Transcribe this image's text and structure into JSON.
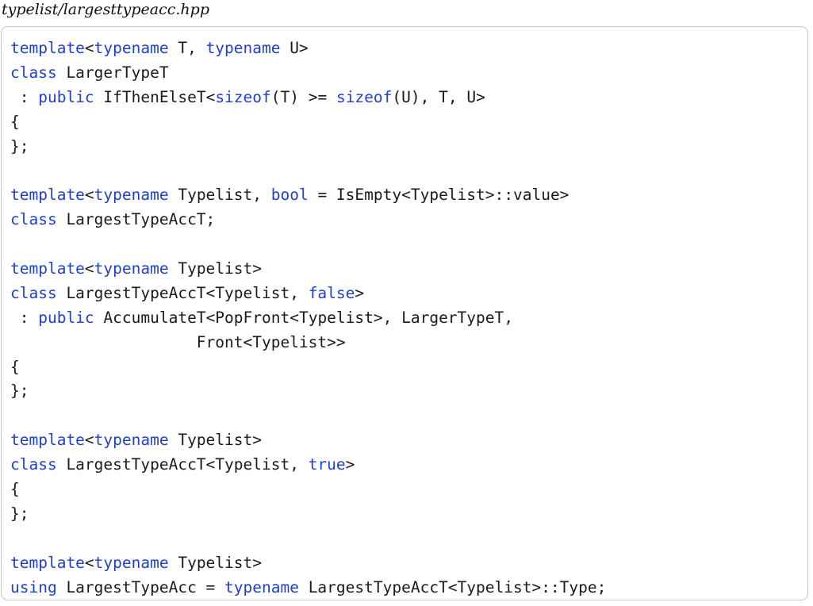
{
  "file": {
    "name": "typelist/largesttypeacc.hpp"
  },
  "colors": {
    "keyword": "#1f3fd1",
    "text": "#1a1a1a",
    "border": "#c8c8c8"
  },
  "code_lines": [
    [
      [
        "kw",
        "template"
      ],
      [
        "t",
        "<"
      ],
      [
        "kw",
        "typename"
      ],
      [
        "t",
        " T, "
      ],
      [
        "kw",
        "typename"
      ],
      [
        "t",
        " U>"
      ]
    ],
    [
      [
        "kw",
        "class"
      ],
      [
        "t",
        " LargerTypeT"
      ]
    ],
    [
      [
        "t",
        " : "
      ],
      [
        "kw",
        "public"
      ],
      [
        "t",
        " IfThenElseT<"
      ],
      [
        "kw",
        "sizeof"
      ],
      [
        "t",
        "(T) >= "
      ],
      [
        "kw",
        "sizeof"
      ],
      [
        "t",
        "(U), T, U>"
      ]
    ],
    [
      [
        "t",
        "{"
      ]
    ],
    [
      [
        "t",
        "};"
      ]
    ],
    [],
    [
      [
        "kw",
        "template"
      ],
      [
        "t",
        "<"
      ],
      [
        "kw",
        "typename"
      ],
      [
        "t",
        " Typelist, "
      ],
      [
        "kw",
        "bool"
      ],
      [
        "t",
        " = IsEmpty<Typelist>::value>"
      ]
    ],
    [
      [
        "kw",
        "class"
      ],
      [
        "t",
        " LargestTypeAccT;"
      ]
    ],
    [],
    [
      [
        "kw",
        "template"
      ],
      [
        "t",
        "<"
      ],
      [
        "kw",
        "typename"
      ],
      [
        "t",
        " Typelist>"
      ]
    ],
    [
      [
        "kw",
        "class"
      ],
      [
        "t",
        " LargestTypeAccT<Typelist, "
      ],
      [
        "kw",
        "false"
      ],
      [
        "t",
        ">"
      ]
    ],
    [
      [
        "t",
        " : "
      ],
      [
        "kw",
        "public"
      ],
      [
        "t",
        " AccumulateT<PopFront<Typelist>, LargerTypeT,"
      ]
    ],
    [
      [
        "t",
        "                    Front<Typelist>>"
      ]
    ],
    [
      [
        "t",
        "{"
      ]
    ],
    [
      [
        "t",
        "};"
      ]
    ],
    [],
    [
      [
        "kw",
        "template"
      ],
      [
        "t",
        "<"
      ],
      [
        "kw",
        "typename"
      ],
      [
        "t",
        " Typelist>"
      ]
    ],
    [
      [
        "kw",
        "class"
      ],
      [
        "t",
        " LargestTypeAccT<Typelist, "
      ],
      [
        "kw",
        "true"
      ],
      [
        "t",
        ">"
      ]
    ],
    [
      [
        "t",
        "{"
      ]
    ],
    [
      [
        "t",
        "};"
      ]
    ],
    [],
    [
      [
        "kw",
        "template"
      ],
      [
        "t",
        "<"
      ],
      [
        "kw",
        "typename"
      ],
      [
        "t",
        " Typelist>"
      ]
    ],
    [
      [
        "kw",
        "using"
      ],
      [
        "t",
        " LargestTypeAcc = "
      ],
      [
        "kw",
        "typename"
      ],
      [
        "t",
        " LargestTypeAccT<Typelist>::Type;"
      ]
    ]
  ]
}
